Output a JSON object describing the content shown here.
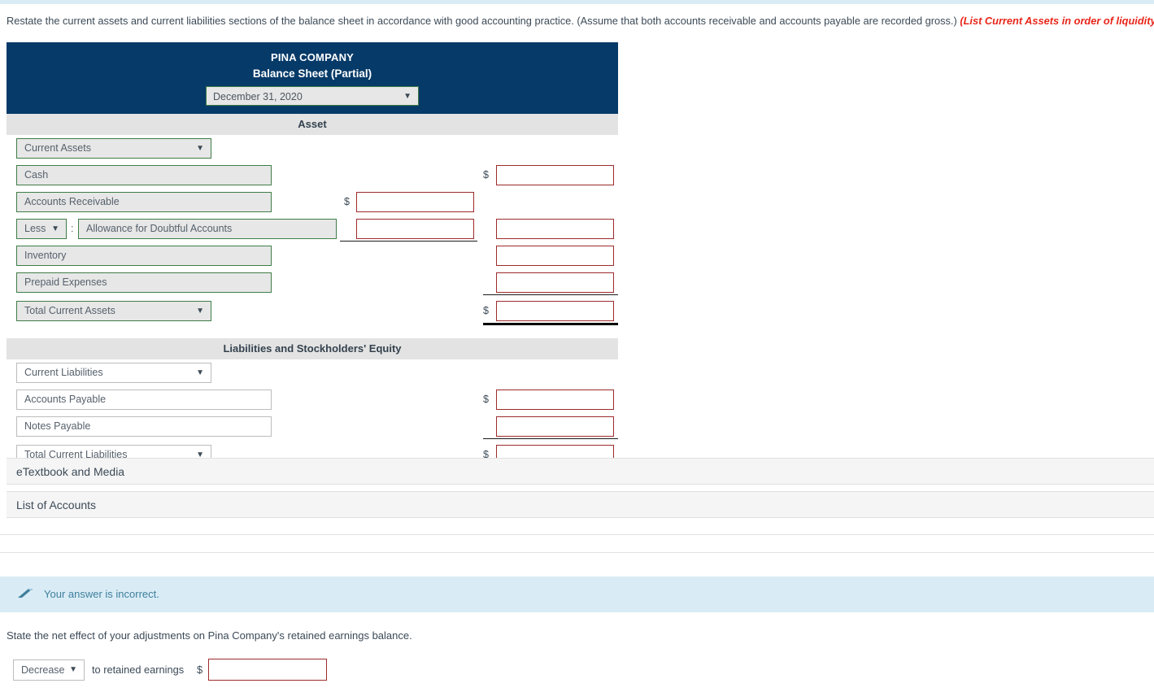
{
  "instruction": {
    "main": "Restate the current assets and current liabilities sections of the balance sheet in accordance with good accounting practice. (Assume that both accounts receivable and accounts payable are recorded gross.)",
    "hint": "(List Current Assets in order of liquidity.)"
  },
  "sheet": {
    "company": "PINA COMPANY",
    "title": "Balance Sheet (Partial)",
    "date_value": "December 31, 2020",
    "caret": "▼",
    "dollar": "$",
    "colon": ":",
    "asset_band": "Asset",
    "liab_band": "Liabilities and Stockholders' Equity",
    "asset_rows": {
      "section": "Current Assets",
      "cash": "Cash",
      "accounts_receivable": "Accounts Receivable",
      "less": "Less",
      "allowance": "Allowance for Doubtful Accounts",
      "inventory": "Inventory",
      "prepaid": "Prepaid Expenses",
      "total": "Total Current Assets"
    },
    "liability_rows": {
      "section": "Current Liabilities",
      "accounts_payable": "Accounts Payable",
      "notes_payable": "Notes Payable",
      "total": "Total Current Liabilities"
    },
    "amount_values": {
      "cash": "",
      "ar_gross": "",
      "allowance": "",
      "ar_net": "",
      "inventory": "",
      "prepaid": "",
      "total_assets": "",
      "accounts_payable": "",
      "notes_payable": "",
      "total_liabilities": ""
    }
  },
  "accordions": {
    "etextbook": "eTextbook and Media",
    "list_of_accounts": "List of Accounts"
  },
  "alert": {
    "text": "Your answer is incorrect.",
    "icon": "eraser-icon",
    "bg": "#d9ecf6",
    "fg": "#3f7f9c"
  },
  "question": {
    "prompt": "State the net effect of your adjustments on Pina Company's retained earnings balance.",
    "direction_value": "Decrease",
    "caret": "▼",
    "middle_label": "to retained earnings",
    "dollar": "$",
    "amount_value": ""
  },
  "colors": {
    "header_navy": "#063a68",
    "band_gray": "#e3e3e3",
    "green_border": "#3f7d46",
    "red_border": "#9d2b2b",
    "hint_red": "#e8261a"
  }
}
